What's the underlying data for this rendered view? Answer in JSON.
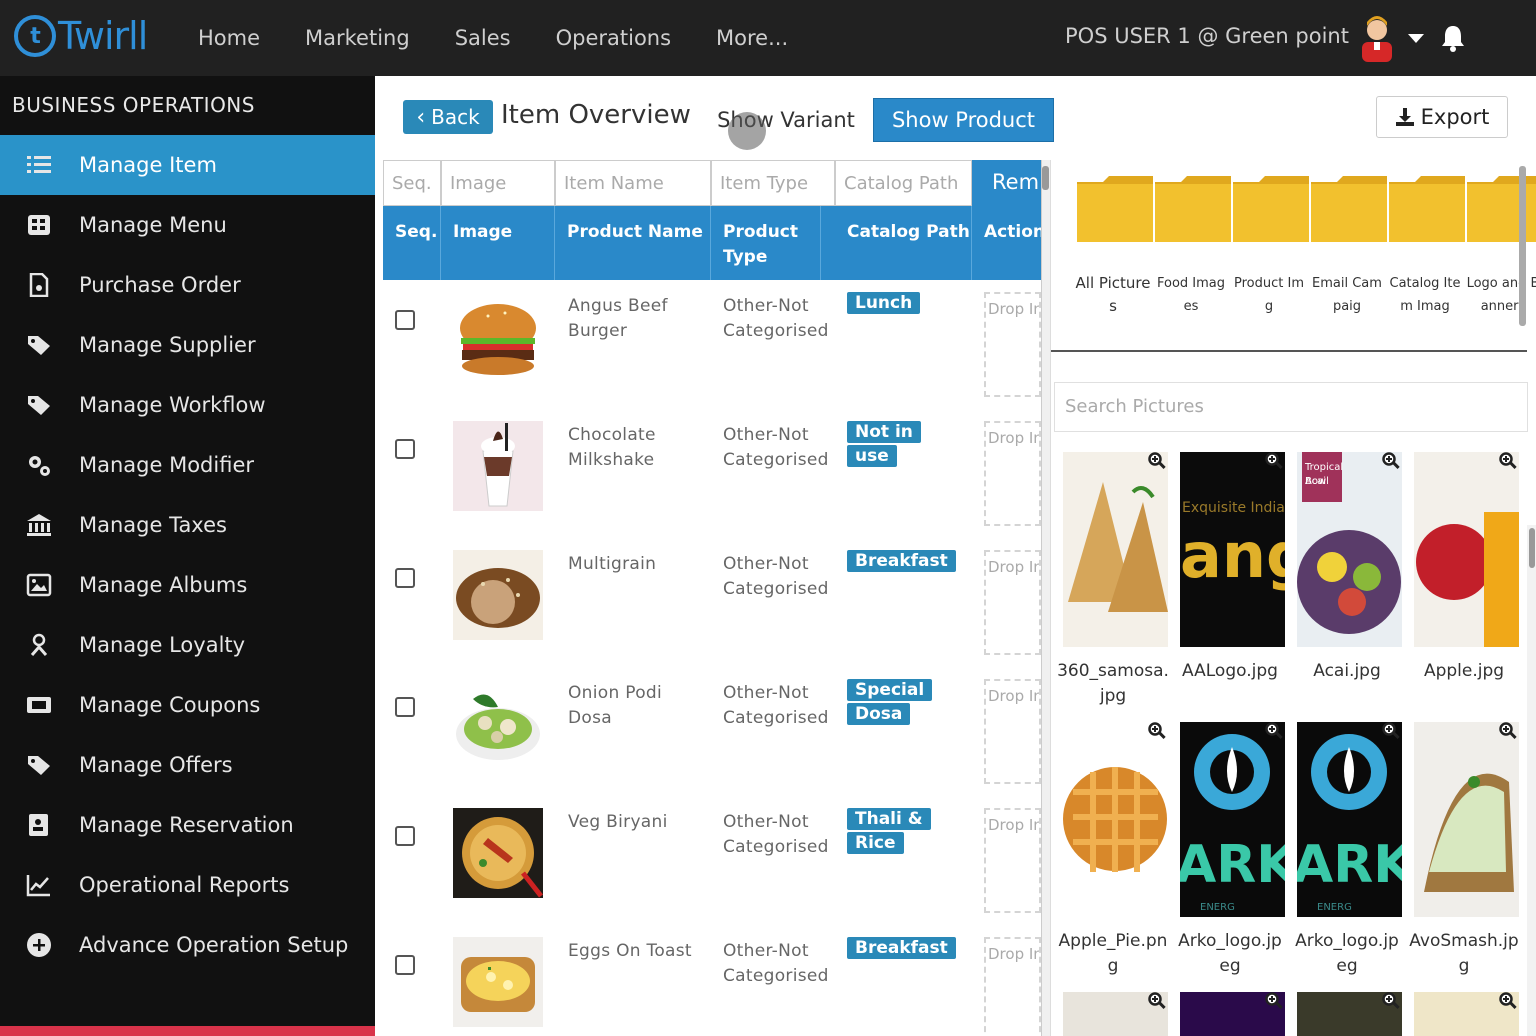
{
  "brand": {
    "name": "Twirll",
    "accent": "#2f8fd8"
  },
  "nav": {
    "items": [
      "Home",
      "Marketing",
      "Sales",
      "Operations",
      "More..."
    ]
  },
  "user": {
    "label": "POS USER 1 @ Green point"
  },
  "sidebar": {
    "title": "BUSINESS OPERATIONS",
    "items": [
      {
        "label": "Manage Item",
        "icon": "list-icon",
        "active": true
      },
      {
        "label": "Manage Menu",
        "icon": "grid-icon"
      },
      {
        "label": "Purchase Order",
        "icon": "file-icon"
      },
      {
        "label": "Manage Supplier",
        "icon": "tags-icon"
      },
      {
        "label": "Manage Workflow",
        "icon": "tags-icon"
      },
      {
        "label": "Manage Modifier",
        "icon": "cogs-icon"
      },
      {
        "label": "Manage Taxes",
        "icon": "bank-icon"
      },
      {
        "label": "Manage Albums",
        "icon": "image-icon"
      },
      {
        "label": "Manage Loyalty",
        "icon": "loyalty-icon"
      },
      {
        "label": "Manage Coupons",
        "icon": "ticket-icon"
      },
      {
        "label": "Manage Offers",
        "icon": "tags-icon"
      },
      {
        "label": "Manage Reservation",
        "icon": "contact-icon"
      },
      {
        "label": "Operational Reports",
        "icon": "chart-icon"
      },
      {
        "label": "Advance Operation Setup",
        "icon": "plus-circle-icon"
      }
    ]
  },
  "header": {
    "back_label": "Back",
    "title": "Item Overview",
    "show_variant_label": "Show Variant",
    "show_product_label": "Show Product",
    "export_label": "Export"
  },
  "table": {
    "filters": [
      "Seq.",
      "Image",
      "Item Name",
      "Item Type",
      "Catalog Path",
      "Rem"
    ],
    "columns": [
      "Seq.",
      "Image",
      "Product Name",
      "Product Type",
      "Catalog Path",
      "Action"
    ],
    "drop_label": "Drop In",
    "rows": [
      {
        "name": "Angus Beef Burger",
        "type": "Other-Not Categorised",
        "catalog": "Lunch",
        "image": "burger"
      },
      {
        "name": "Chocolate Milkshake",
        "type": "Other-Not Categorised",
        "catalog": "Not in use",
        "image": "milkshake"
      },
      {
        "name": "Multigrain",
        "type": "Other-Not Categorised",
        "catalog": "Breakfast",
        "image": "bread"
      },
      {
        "name": "Onion Podi Dosa",
        "type": "Other-Not Categorised",
        "catalog": "Special Dosa",
        "image": "salad"
      },
      {
        "name": "Veg Biryani",
        "type": "Other-Not Categorised",
        "catalog": "Thali & Rice",
        "image": "biryani"
      },
      {
        "name": "Eggs On Toast",
        "type": "Other-Not Categorised",
        "catalog": "Breakfast",
        "image": "eggs"
      }
    ]
  },
  "gallery": {
    "folders": [
      {
        "label": "All Pictures"
      },
      {
        "label": "Food Images"
      },
      {
        "label": "Product Img"
      },
      {
        "label": "Email Campaig"
      },
      {
        "label": "Catalog Item Imag"
      },
      {
        "label": "Logo and Banners"
      }
    ],
    "search_placeholder": "Search Pictures",
    "pictures": [
      {
        "name": "360_samosa.jpg"
      },
      {
        "name": "AALogo.jpg",
        "overlay": "Exquisite Indian",
        "big": "ang"
      },
      {
        "name": "Acai.jpg",
        "overlay": "Tropical Acai Bowl"
      },
      {
        "name": "Apple.jpg"
      },
      {
        "name": "Apple_Pie.png"
      },
      {
        "name": "Arko_logo.jpeg",
        "big": "ARK",
        "sub": "ENERG"
      },
      {
        "name": "Arko_logo.jpeg",
        "big": "ARK",
        "sub": "ENERG"
      },
      {
        "name": "AvoSmash.jpg"
      }
    ]
  },
  "colors": {
    "primary": "#2a89c9",
    "sidebar_bg": "#111111",
    "topbar_bg": "#212121",
    "folder": "#f2c12e"
  }
}
